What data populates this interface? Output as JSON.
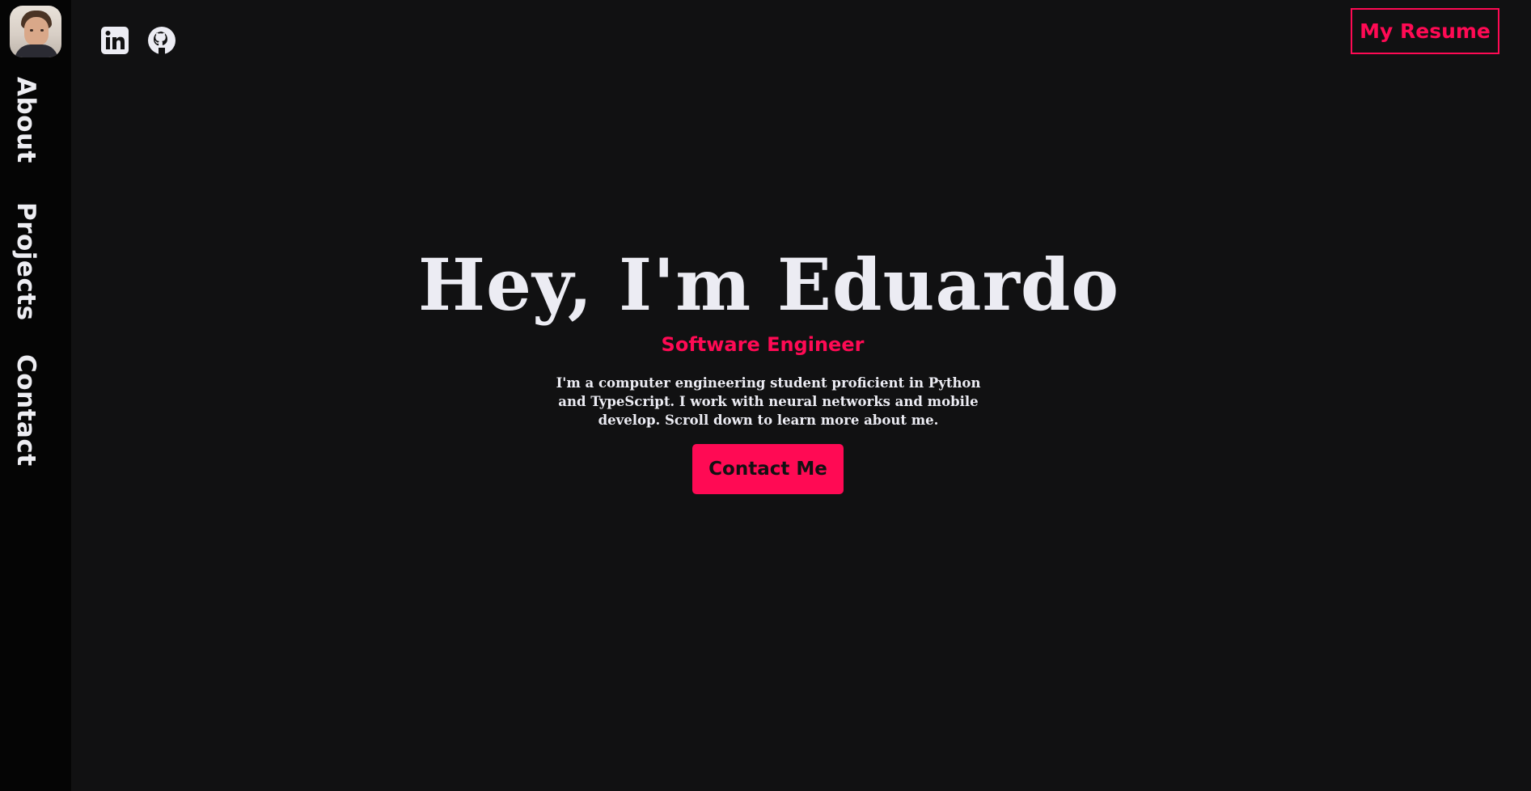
{
  "sidebar": {
    "avatar_icon": "profile-photo",
    "items": [
      {
        "label": "About"
      },
      {
        "label": "Projects"
      },
      {
        "label": "Contact"
      }
    ]
  },
  "header": {
    "social_icons": [
      "linkedin-icon",
      "github-icon"
    ],
    "resume_label": "My Resume"
  },
  "hero": {
    "title": "Hey, I'm Eduardo",
    "subtitle": "Software Engineer",
    "description": "I'm a computer engineering student proficient in Python and TypeScript. I work with neural networks and mobile develop. Scroll down to learn more about me.",
    "cta_label": "Contact Me"
  },
  "colors": {
    "background": "#111112",
    "sidebar": "#050505",
    "accent": "#ff0a54",
    "text": "#ececf3"
  }
}
